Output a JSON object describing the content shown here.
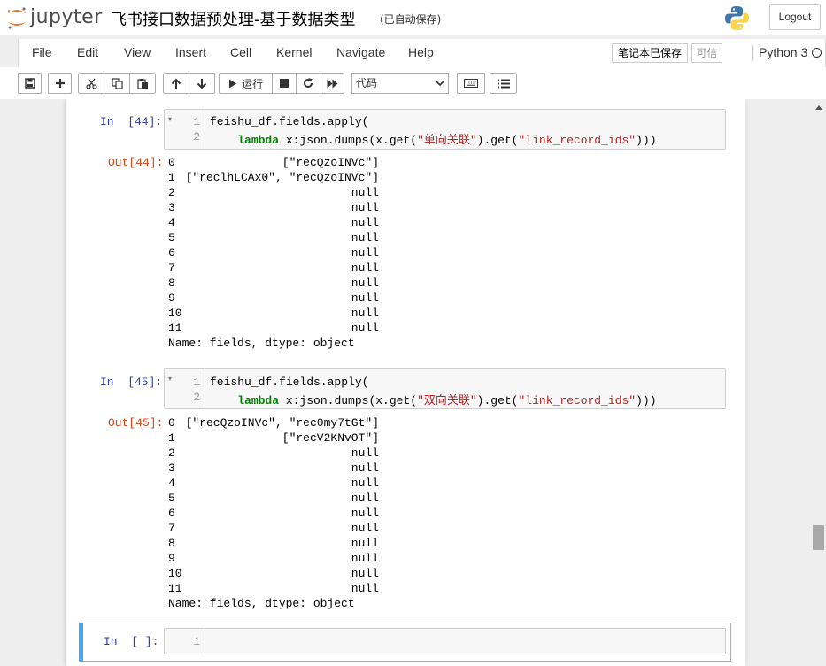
{
  "header": {
    "logo_text": "jupyter",
    "notebook_title": "飞书接口数据预处理-基于数据类型",
    "autosave_status": "(已自动保存)",
    "logout_label": "Logout"
  },
  "menubar": {
    "items": [
      "File",
      "Edit",
      "View",
      "Insert",
      "Cell",
      "Kernel",
      "Navigate",
      "Help"
    ],
    "trusted_status": "笔记本已保存",
    "trusted_button": "可信",
    "kernel_name": "Python 3"
  },
  "toolbar": {
    "run_label": "运行",
    "cell_type": "代码",
    "buttons": [
      "save-icon",
      "plus-icon",
      "cut-icon",
      "copy-icon",
      "paste-icon",
      "arrow-up-icon",
      "arrow-down-icon",
      "play-icon",
      "stop-icon",
      "restart-icon",
      "fast-forward-icon",
      "keyboard-icon",
      "list-icon"
    ]
  },
  "cells": [
    {
      "in_prompt": "In  [44]:",
      "line_numbers": [
        "1",
        "2"
      ],
      "code_line1": "feishu_df.fields.apply(",
      "code_line2_indent": "    ",
      "code_line2_kw": "lambda",
      "code_line2_a": " x:json.dumps(x.get(",
      "code_line2_str1": "\"单向关联\"",
      "code_line2_b": ").get(",
      "code_line2_str2": "\"link_record_ids\"",
      "code_line2_c": ")))",
      "out_prompt": "Out[44]:",
      "output_rows": [
        {
          "index": "0",
          "value": "[\"recQzoINVc\"]"
        },
        {
          "index": "1",
          "value": "[\"reclhLCAx0\", \"recQzoINVc\"]"
        },
        {
          "index": "2",
          "value": "null"
        },
        {
          "index": "3",
          "value": "null"
        },
        {
          "index": "4",
          "value": "null"
        },
        {
          "index": "5",
          "value": "null"
        },
        {
          "index": "6",
          "value": "null"
        },
        {
          "index": "7",
          "value": "null"
        },
        {
          "index": "8",
          "value": "null"
        },
        {
          "index": "9",
          "value": "null"
        },
        {
          "index": "10",
          "value": "null"
        },
        {
          "index": "11",
          "value": "null"
        }
      ],
      "output_footer": "Name: fields, dtype: object"
    },
    {
      "in_prompt": "In  [45]:",
      "line_numbers": [
        "1",
        "2"
      ],
      "code_line1": "feishu_df.fields.apply(",
      "code_line2_indent": "    ",
      "code_line2_kw": "lambda",
      "code_line2_a": " x:json.dumps(x.get(",
      "code_line2_str1": "\"双向关联\"",
      "code_line2_b": ").get(",
      "code_line2_str2": "\"link_record_ids\"",
      "code_line2_c": ")))",
      "out_prompt": "Out[45]:",
      "output_rows": [
        {
          "index": "0",
          "value": "[\"recQzoINVc\", \"rec0my7tGt\"]"
        },
        {
          "index": "1",
          "value": "[\"recV2KNvOT\"]"
        },
        {
          "index": "2",
          "value": "null"
        },
        {
          "index": "3",
          "value": "null"
        },
        {
          "index": "4",
          "value": "null"
        },
        {
          "index": "5",
          "value": "null"
        },
        {
          "index": "6",
          "value": "null"
        },
        {
          "index": "7",
          "value": "null"
        },
        {
          "index": "8",
          "value": "null"
        },
        {
          "index": "9",
          "value": "null"
        },
        {
          "index": "10",
          "value": "null"
        },
        {
          "index": "11",
          "value": "null"
        }
      ],
      "output_footer": "Name: fields, dtype: object"
    },
    {
      "in_prompt": "In  [ ]:",
      "line_numbers": [
        "1"
      ]
    }
  ],
  "colors": {
    "in_prompt": "#303f9f",
    "out_prompt": "#d84315",
    "keyword": "#008000",
    "string": "#ba2121",
    "selected_cell_bar": "#42a5f5",
    "logo_orange": "#f37726"
  }
}
